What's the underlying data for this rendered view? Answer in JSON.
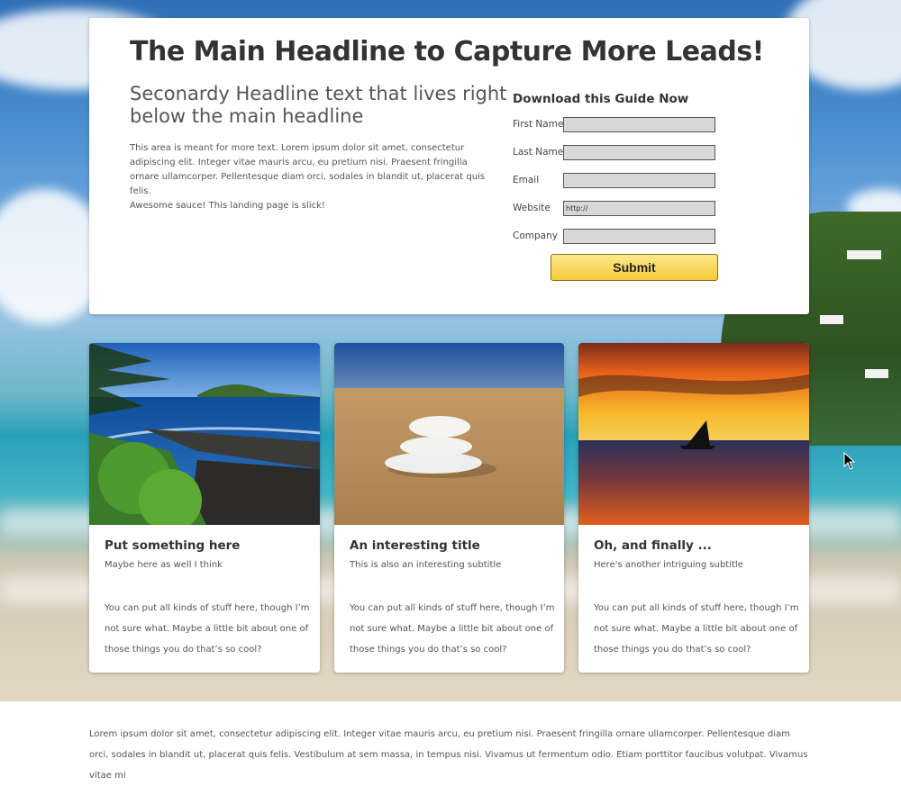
{
  "hero": {
    "main_headline": "The Main Headline to Capture More Leads!",
    "secondary_headline": "Seconardy Headline text that lives right below the main headline",
    "body_line1": "This area is meant for more text. Lorem ipsum dolor sit amet, consectetur adipiscing elit. Integer vitae mauris arcu, eu pretium nisi. Praesent fringilla ornare ullamcorper. Pellentesque diam orci, sodales in blandit ut, placerat quis felis.",
    "body_line2": "Awesome sauce! This landing page is slick!"
  },
  "form": {
    "title": "Download this Guide Now",
    "fields": [
      {
        "label": "First Name",
        "value": ""
      },
      {
        "label": "Last Name",
        "value": ""
      },
      {
        "label": "Email",
        "value": ""
      },
      {
        "label": "Website",
        "value": "http://"
      },
      {
        "label": "Company",
        "value": ""
      }
    ],
    "submit_label": "Submit"
  },
  "cards": [
    {
      "title": "Put something here",
      "subtitle": "Maybe here as well I think",
      "body": "You can put all kinds of stuff here, though I’m not sure what. Maybe a little bit about one of those things you do that’s so cool?",
      "image": "rocky-coast-photo"
    },
    {
      "title": "An interesting title",
      "subtitle": "This is also an interesting subtitle",
      "body": "You can put all kinds of stuff here, though I’m not sure what. Maybe a little bit about one of those things you do that’s so cool?",
      "image": "stacked-stones-photo"
    },
    {
      "title": "Oh, and finally ...",
      "subtitle": "Here's another intriguing subtitle",
      "body": "You can put all kinds of stuff here, though I’m not sure what. Maybe a little bit about one of those things you do that’s so cool?",
      "image": "sunset-sailboat-photo"
    }
  ],
  "footer": {
    "text": "Lorem ipsum dolor sit amet, consectetur adipiscing elit. Integer vitae mauris arcu, eu pretium nisi. Praesent fringilla ornare ullamcorper. Pellentesque diam orci, sodales in blandit ut, placerat quis felis. Vestibulum at sem massa, in tempus nisi. Vivamus ut fermentum odio. Etiam porttitor faucibus volutpat. Vivamus vitae mi"
  },
  "colors": {
    "submit_top": "#fde98a",
    "submit_bottom": "#f5c93d",
    "card_bg": "#ffffff",
    "text": "#333333"
  }
}
